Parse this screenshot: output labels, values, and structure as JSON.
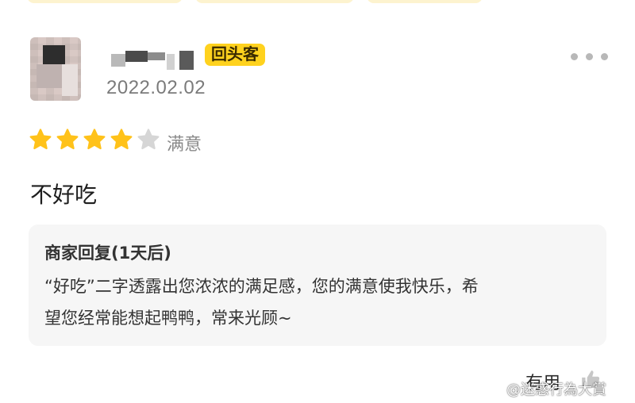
{
  "reviewer": {
    "badge": "回头客",
    "date": "2022.02.02"
  },
  "rating": {
    "stars_filled": 4,
    "stars_total": 5,
    "label": "满意",
    "star_color": "#ffc21a",
    "star_empty_color": "#d6d6d6"
  },
  "review": {
    "text": "不好吃"
  },
  "merchant_reply": {
    "title": "商家回复(1天后)",
    "lines": [
      "“好吃”二字透露出您浓浓的满足感，您的满意使我快乐，希",
      "望您经常能想起鸭鸭，常来光顾~"
    ]
  },
  "actions": {
    "useful_label": "有用",
    "more_icon": "more-dots-icon",
    "thumb_icon": "thumbs-up-icon"
  },
  "watermark": {
    "text": "@迷惑行為大賞",
    "icon": "weibo-icon"
  },
  "colors": {
    "badge_bg": "#ffd21e",
    "reply_bg": "#f6f6f6",
    "chip_bg": "#fdf3cf"
  }
}
